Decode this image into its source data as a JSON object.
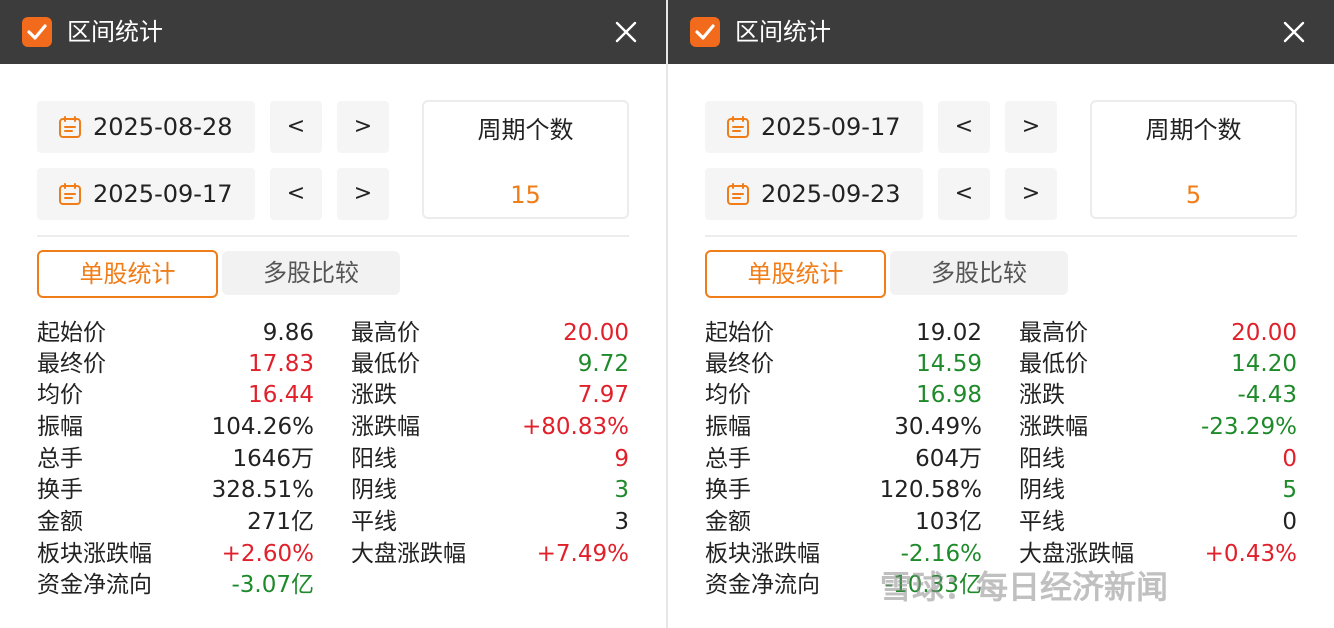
{
  "colors": {
    "accent": "#f07d18",
    "up": "#e0202b",
    "down": "#1e8a2a",
    "titlebar": "#3c3c3c"
  },
  "panels": [
    {
      "title": "区间统计",
      "start_date": "2025-08-28",
      "end_date": "2025-09-17",
      "prev_label": "<",
      "next_label": ">",
      "period_label": "周期个数",
      "period_value": "15",
      "tabs": [
        "单股统计",
        "多股比较"
      ],
      "left_stats": [
        {
          "label": "起始价",
          "value": "9.86",
          "color": "black"
        },
        {
          "label": "最终价",
          "value": "17.83",
          "color": "red"
        },
        {
          "label": "均价",
          "value": "16.44",
          "color": "red"
        },
        {
          "label": "振幅",
          "value": "104.26%",
          "color": "black"
        },
        {
          "label": "总手",
          "value": "1646万",
          "color": "black"
        },
        {
          "label": "换手",
          "value": "328.51%",
          "color": "black"
        },
        {
          "label": "金额",
          "value": "271亿",
          "color": "black"
        },
        {
          "label": "板块涨跌幅",
          "value": "+2.60%",
          "color": "red"
        },
        {
          "label": "资金净流向",
          "value": "-3.07亿",
          "color": "green"
        }
      ],
      "right_stats": [
        {
          "label": "最高价",
          "value": "20.00",
          "color": "red"
        },
        {
          "label": "最低价",
          "value": "9.72",
          "color": "green"
        },
        {
          "label": "涨跌",
          "value": "7.97",
          "color": "red"
        },
        {
          "label": "涨跌幅",
          "value": "+80.83%",
          "color": "red"
        },
        {
          "label": "阳线",
          "value": "9",
          "color": "red"
        },
        {
          "label": "阴线",
          "value": "3",
          "color": "green"
        },
        {
          "label": "平线",
          "value": "3",
          "color": "black"
        },
        {
          "label": "大盘涨跌幅",
          "value": "+7.49%",
          "color": "red"
        }
      ]
    },
    {
      "title": "区间统计",
      "start_date": "2025-09-17",
      "end_date": "2025-09-23",
      "prev_label": "<",
      "next_label": ">",
      "period_label": "周期个数",
      "period_value": "5",
      "tabs": [
        "单股统计",
        "多股比较"
      ],
      "left_stats": [
        {
          "label": "起始价",
          "value": "19.02",
          "color": "black"
        },
        {
          "label": "最终价",
          "value": "14.59",
          "color": "green"
        },
        {
          "label": "均价",
          "value": "16.98",
          "color": "green"
        },
        {
          "label": "振幅",
          "value": "30.49%",
          "color": "black"
        },
        {
          "label": "总手",
          "value": "604万",
          "color": "black"
        },
        {
          "label": "换手",
          "value": "120.58%",
          "color": "black"
        },
        {
          "label": "金额",
          "value": "103亿",
          "color": "black"
        },
        {
          "label": "板块涨跌幅",
          "value": "-2.16%",
          "color": "green"
        },
        {
          "label": "资金净流向",
          "value": "-10.33亿",
          "color": "green"
        }
      ],
      "right_stats": [
        {
          "label": "最高价",
          "value": "20.00",
          "color": "red"
        },
        {
          "label": "最低价",
          "value": "14.20",
          "color": "green"
        },
        {
          "label": "涨跌",
          "value": "-4.43",
          "color": "green"
        },
        {
          "label": "涨跌幅",
          "value": "-23.29%",
          "color": "green"
        },
        {
          "label": "阳线",
          "value": "0",
          "color": "red"
        },
        {
          "label": "阴线",
          "value": "5",
          "color": "green"
        },
        {
          "label": "平线",
          "value": "0",
          "color": "black"
        },
        {
          "label": "大盘涨跌幅",
          "value": "+0.43%",
          "color": "red"
        }
      ]
    }
  ],
  "watermark": "雪球：每日经济新闻"
}
